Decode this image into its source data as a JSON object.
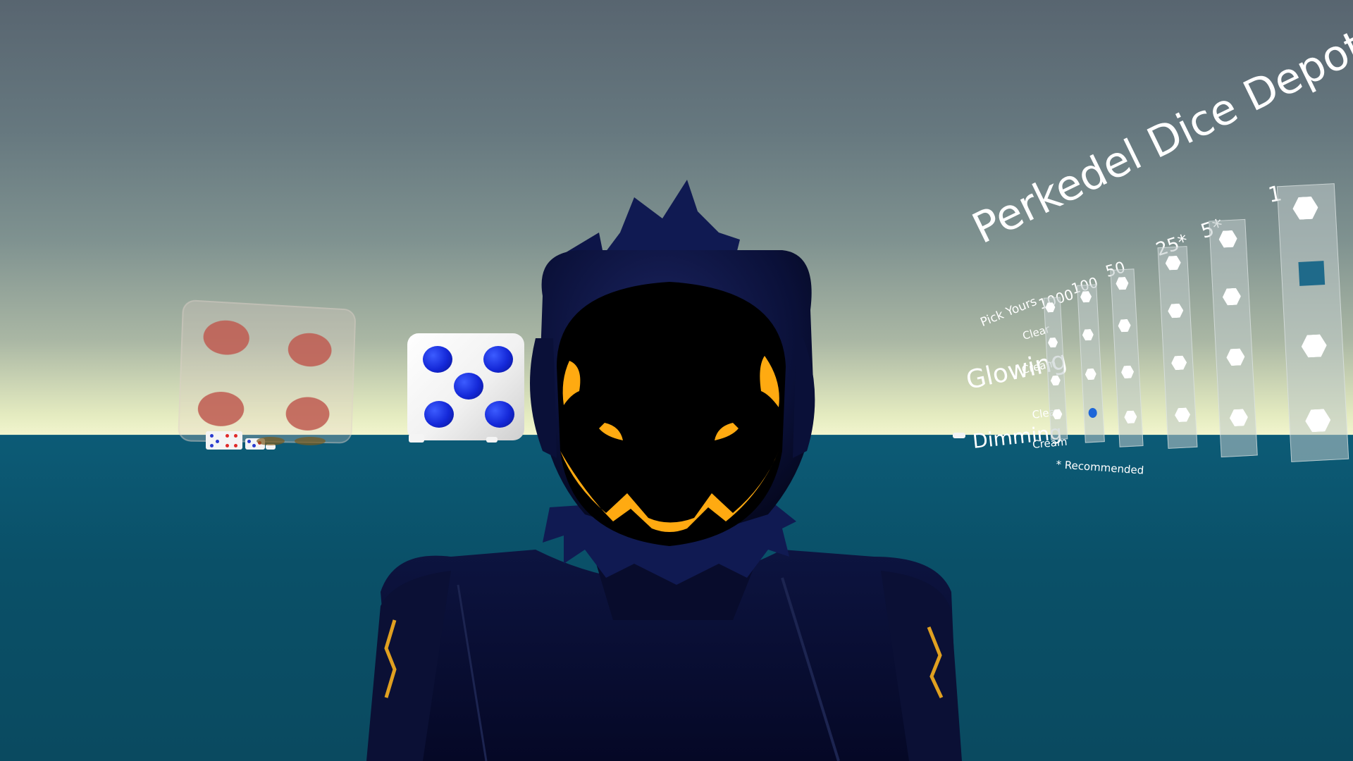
{
  "scene": {
    "colors": {
      "sky_top": "#586570",
      "sky_horizon": "#f3f6cf",
      "ocean": "#0c5b76",
      "avatar_body": "#0a0f2e",
      "visor_glow": "#ffaa11"
    }
  },
  "board": {
    "title": "Perkedel Dice Depot",
    "subtitle": "Pick Yours",
    "groups": [
      {
        "label": "Glowing",
        "variants": [
          "Clear",
          "Cream"
        ]
      },
      {
        "label": "Dimming",
        "variants": [
          "Clear",
          "Cream"
        ]
      }
    ],
    "columns": [
      "1000",
      "100",
      "50",
      "25*",
      "5*",
      "1"
    ],
    "footnote": "* Recommended"
  }
}
